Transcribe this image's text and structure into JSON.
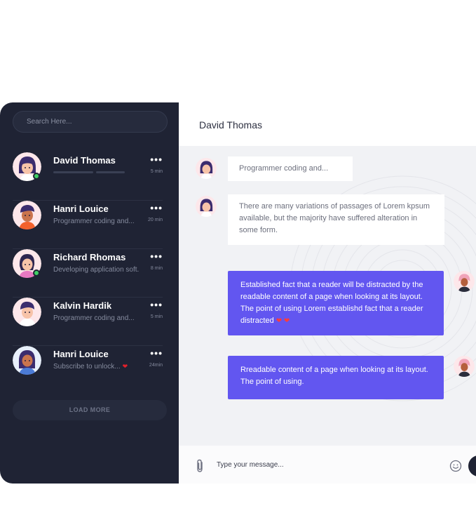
{
  "search": {
    "placeholder": "Search Here..."
  },
  "contacts": [
    {
      "name": "David Thomas",
      "preview": "",
      "time": "5 min",
      "online": true,
      "menu_icon": "more-dots-icon"
    },
    {
      "name": "Hanri Louice",
      "preview": "Programmer coding and...",
      "time": "20 min",
      "online": false,
      "menu_icon": "more-dots-icon"
    },
    {
      "name": "Richard Rhomas",
      "preview": "Developing application soft.",
      "time": "8 min",
      "online": true,
      "menu_icon": "more-dots-icon"
    },
    {
      "name": "Kalvin Hardik",
      "preview": "Programmer coding and...",
      "time": "5 min",
      "online": false,
      "menu_icon": "more-dots-icon"
    },
    {
      "name": "Hanri Louice",
      "preview": "Subscribe to unlock...",
      "time": "24min",
      "online": false,
      "menu_icon": "more-dots-icon"
    }
  ],
  "load_more": "LOAD MORE",
  "chat": {
    "title": "David Thomas",
    "messages": [
      {
        "direction": "in",
        "text": "Programmer coding and..."
      },
      {
        "direction": "in",
        "text": "There are many variations of passages of Lorem kpsum available, but the majority have suffered alteration in some form."
      },
      {
        "direction": "out",
        "text": "Established fact that a reader will be distracted by the readable content of a page when looking at its layout. The point of using Lorem establishd fact that a reader distracted",
        "hearts": "❤ ❤"
      },
      {
        "direction": "out",
        "text": "Rreadable content of a page when looking at its layout. The point of using."
      }
    ],
    "composer": {
      "placeholder": "Type your message..."
    }
  },
  "colors": {
    "sidebar": "#1f2334",
    "accent": "#6256f0",
    "online": "#3fcf65",
    "heart": "#e3202a"
  }
}
